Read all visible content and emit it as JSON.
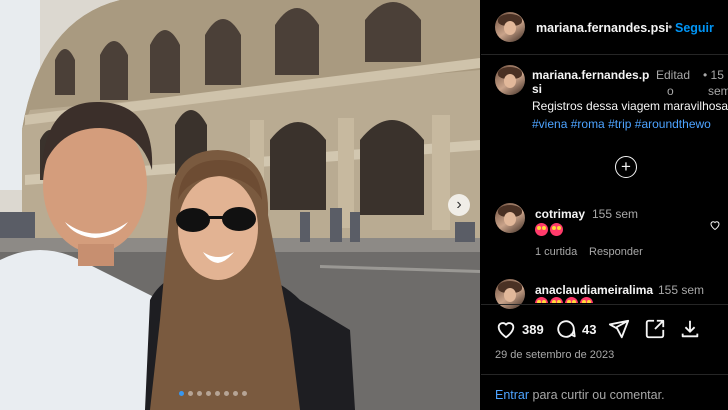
{
  "post": {
    "username": "mariana.fernandes.psi",
    "follow_label": "Seguir",
    "caption_username_line1": "mariana.fernandes.p",
    "caption_username_line2": "si",
    "edited_line1": "Editad",
    "edited_line2": "o",
    "time_line1": "• 15",
    "time_line2": "sem",
    "caption_text": "Registros dessa viagem maravilhosa",
    "hashtags": [
      "#viena",
      "#roma",
      "#trip",
      "#aroundthewo"
    ],
    "view_more_symbol": "+",
    "photo_dots": 8,
    "active_dot": 0
  },
  "comments": [
    {
      "username": "cotrimay",
      "time": "155 sem",
      "likes_label": "1 curtida",
      "reply_label": "Responder",
      "emoji_count": 2
    },
    {
      "username": "anaclaudiameiralima",
      "time": "155 sem",
      "emoji_count": 4
    }
  ],
  "actions": {
    "likes_count": "389",
    "comments_count": "43",
    "icons": [
      "heart-icon",
      "comment-icon",
      "share-icon",
      "expand-icon",
      "save-icon"
    ]
  },
  "date": "29 de setembro de 2023",
  "login_prompt": {
    "link_label": "Entrar",
    "rest_label": "para curtir ou comentar."
  },
  "colors": {
    "background": "#000000",
    "accent_blue": "#0095f6",
    "hashtag_blue": "#4da3ff",
    "muted_text": "#a8a8a8",
    "active_dot": "#3897f0"
  }
}
